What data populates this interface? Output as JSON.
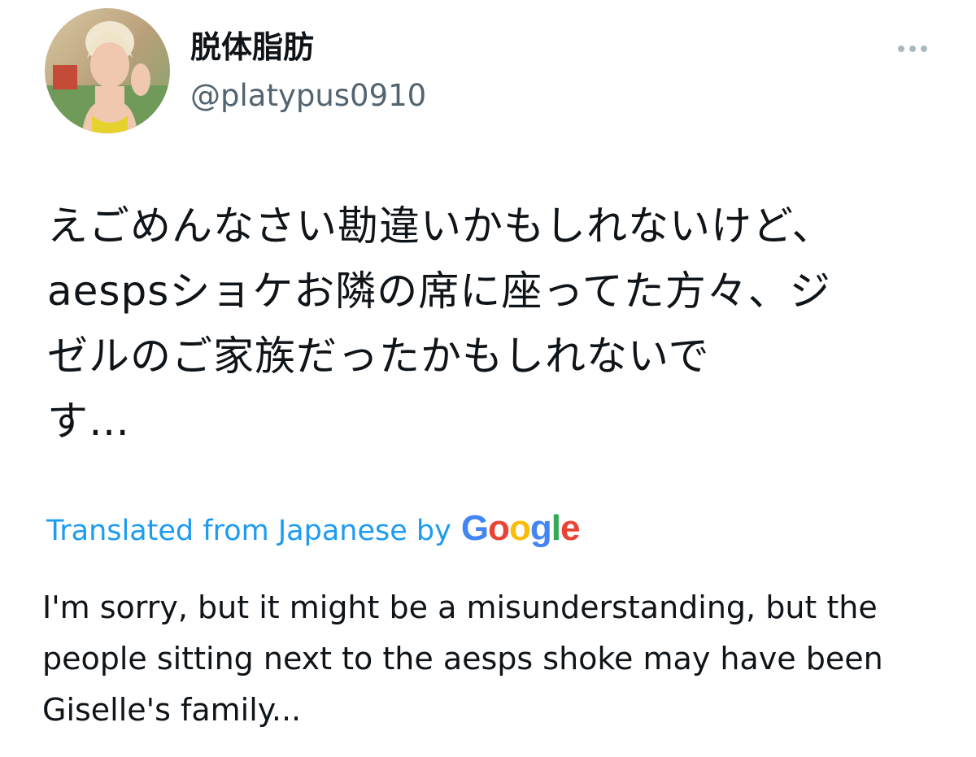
{
  "tweet": {
    "author": {
      "display_name": "脱体脂肪",
      "handle": "@platypus0910"
    },
    "text_ja": "えごめんなさい勘違いかもしれないけど、\naespsショケお隣の席に座ってた方々、ジ\nゼルのご家族だったかもしれないで\nす…",
    "translation": {
      "label": "Translated from Japanese by",
      "provider": "Google",
      "text": "I'm sorry, but it might be a misunderstanding, but the\npeople sitting next to the aesps shoke may have been\nGiselle's family..."
    }
  },
  "icons": {
    "more": "more-options-icon",
    "avatar": "profile-photo"
  },
  "colors": {
    "link_blue": "#1d9bf0",
    "handle_gray": "#536471",
    "text": "#0f1419",
    "google_blue": "#4285f4",
    "google_red": "#ea4335",
    "google_yellow": "#fbbc05",
    "google_green": "#34a853"
  }
}
